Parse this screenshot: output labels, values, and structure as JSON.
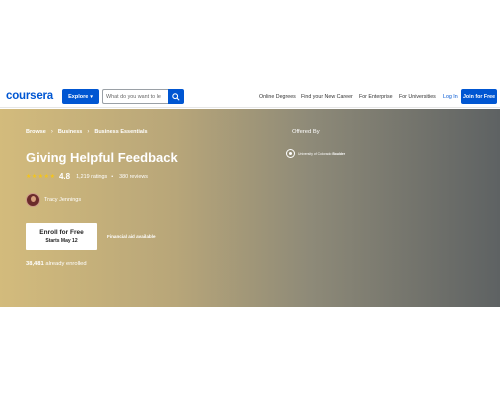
{
  "header": {
    "logo": "coursera",
    "explore_label": "Explore",
    "search_placeholder": "What do you want to learn?",
    "search_value": "What do you want to le",
    "nav": [
      "Online Degrees",
      "Find your New Career",
      "For Enterprise",
      "For Universities"
    ],
    "login_label": "Log In",
    "join_label": "Join for Free"
  },
  "course": {
    "breadcrumb": [
      "Browse",
      "Business",
      "Business Essentials"
    ],
    "title": "Giving Helpful Feedback",
    "rating": "4.8",
    "ratings_count": "1,219 ratings",
    "reviews_count": "380 reviews",
    "instructor": "Tracy Jennings",
    "enroll_label": "Enroll for Free",
    "enroll_sub": "Starts May 12",
    "financial_aid": "Financial aid available",
    "enrolled_count": "38,481",
    "enrolled_suffix": " already enrolled",
    "offered_by": "Offered By",
    "partner_name": "University of Colorado",
    "partner_suffix": "Boulder"
  },
  "colors": {
    "brand": "#0056d2",
    "banner_start": "#d3bb7c",
    "banner_end": "#5e6263",
    "star": "#f5c518"
  }
}
